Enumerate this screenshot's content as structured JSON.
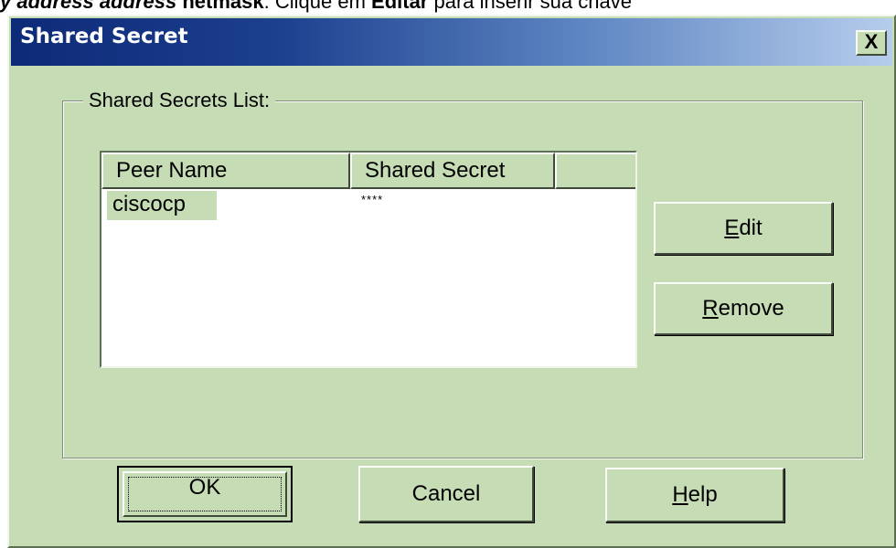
{
  "page_text": {
    "part1": "y address address",
    "part2": " netmask",
    "part3": ". Clique em ",
    "part4": "Editar",
    "part5": " para inserir sua chave"
  },
  "dialog": {
    "title": "Shared Secret",
    "close_label": "X",
    "group_label": "Shared Secrets List:",
    "columns": [
      "Peer Name",
      "Shared Secret",
      ""
    ],
    "rows": [
      {
        "peer_name": "ciscocp",
        "shared_secret": "****"
      }
    ],
    "buttons": {
      "edit_accel": "E",
      "edit_rest": "dit",
      "remove_accel": "R",
      "remove_rest": "emove",
      "ok": "OK",
      "cancel": "Cancel",
      "help_accel": "H",
      "help_rest": "elp"
    }
  }
}
